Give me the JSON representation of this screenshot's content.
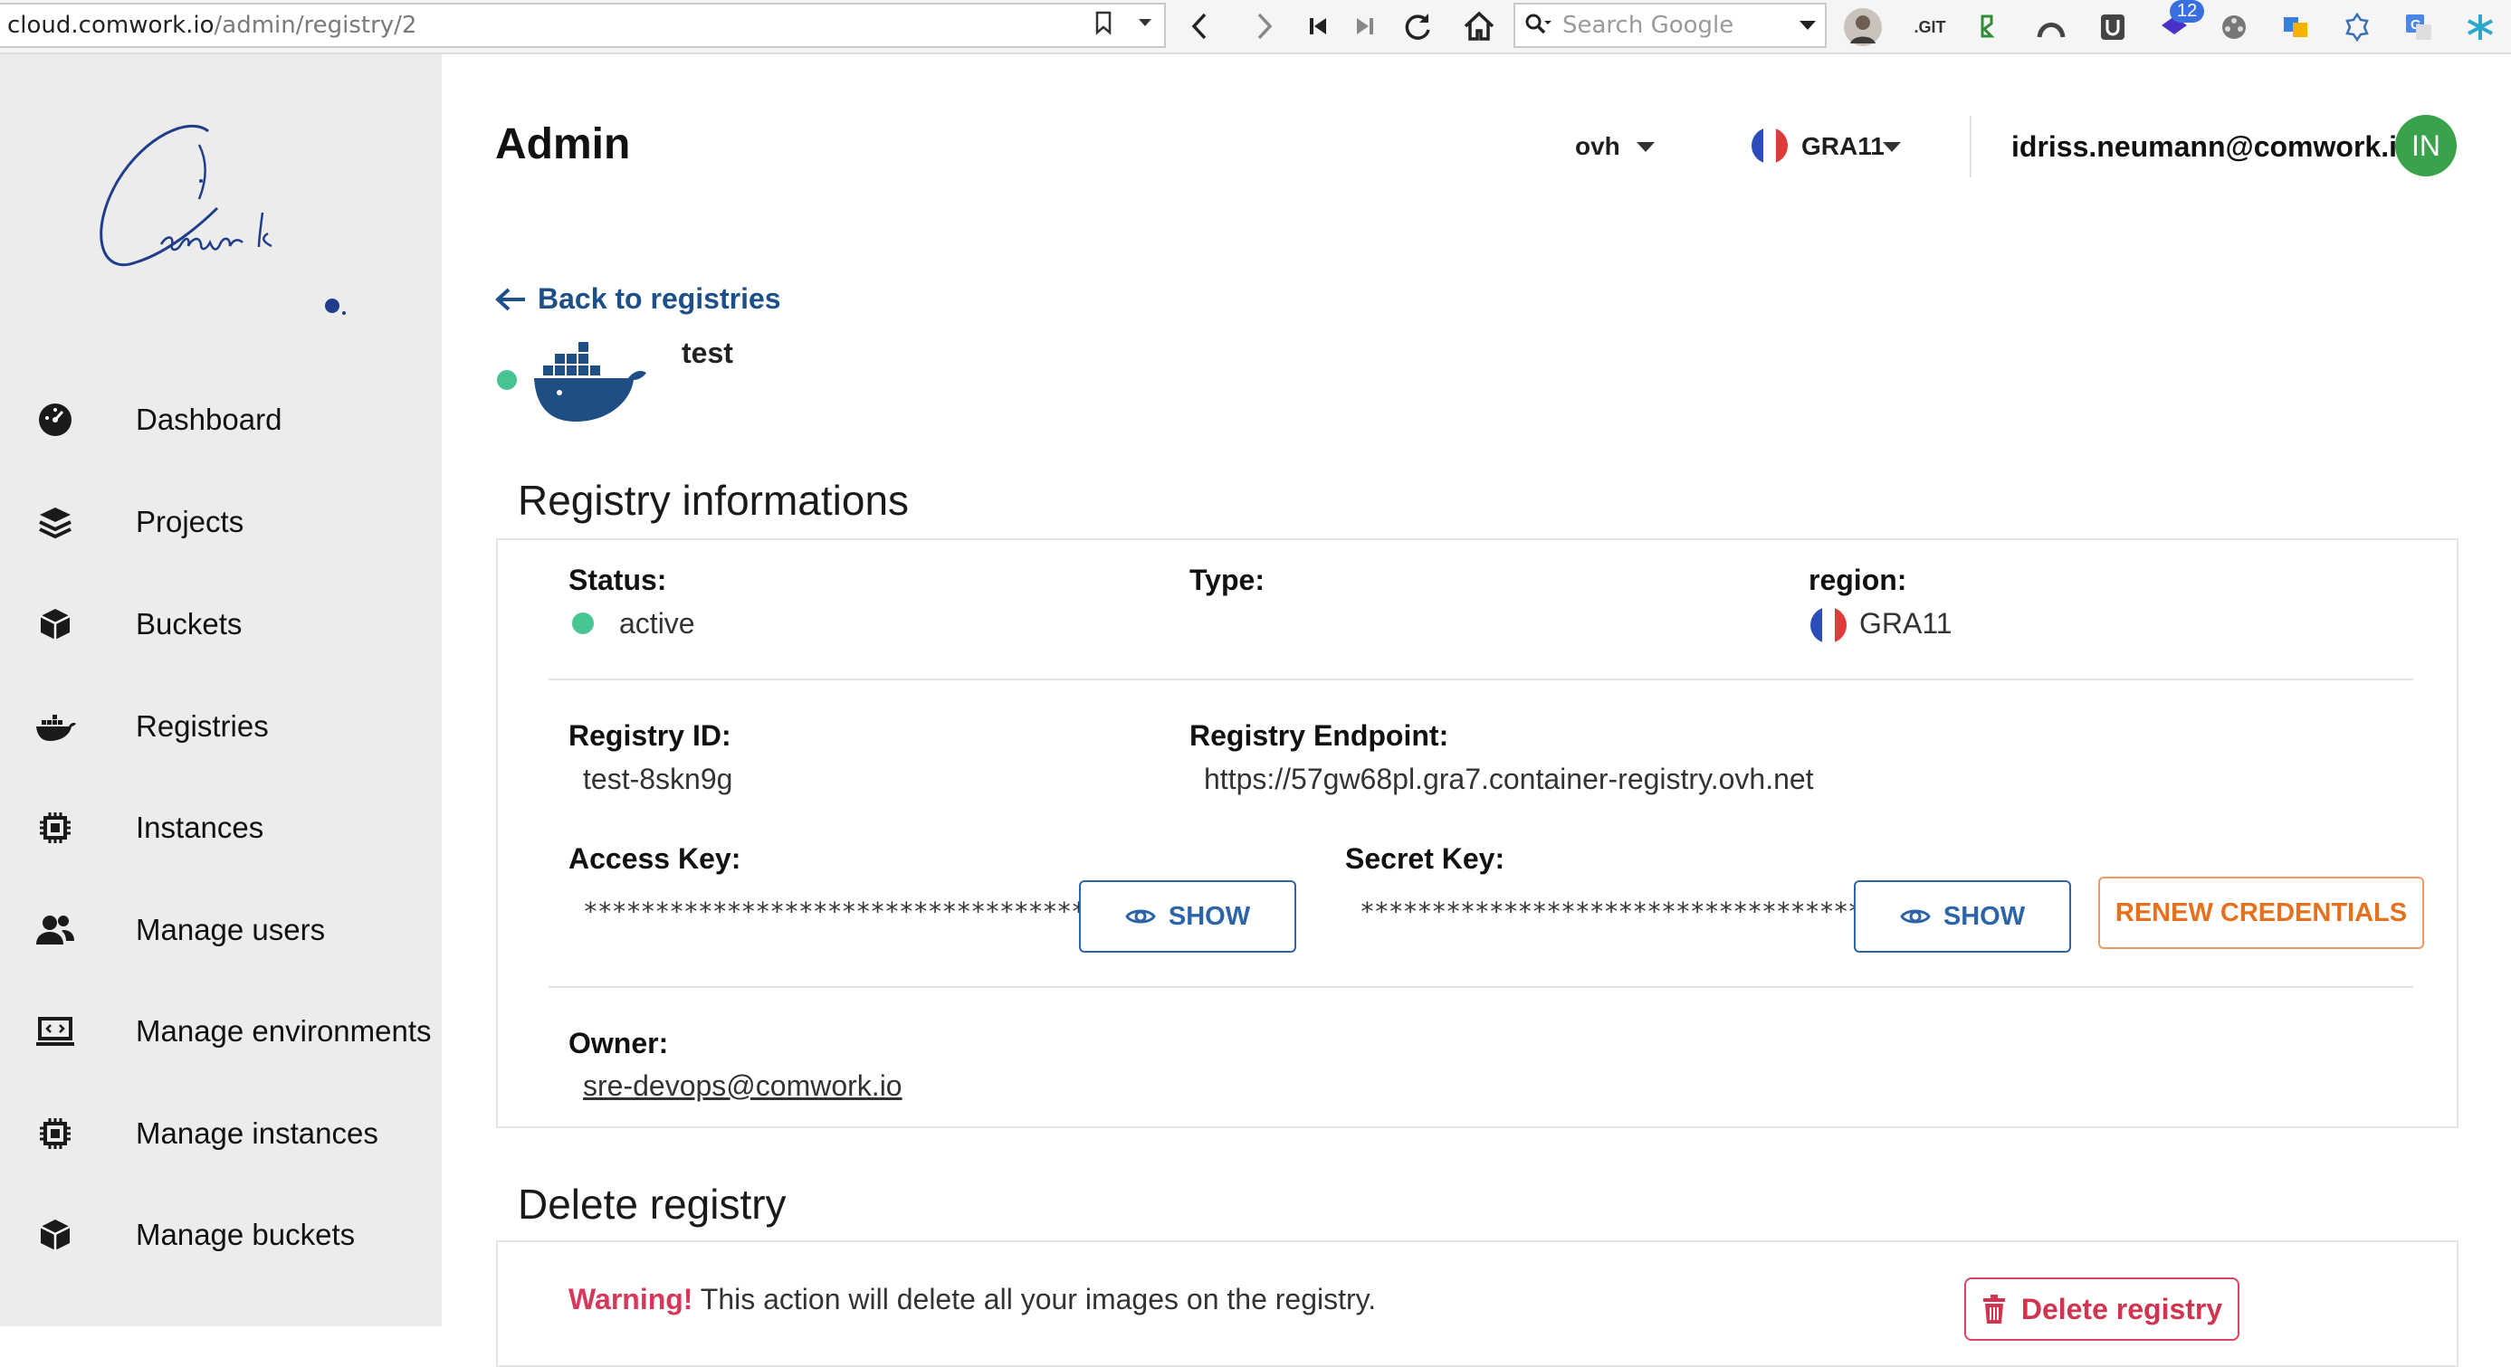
{
  "browser": {
    "url_host": "cloud.comwork.io",
    "url_path": "/admin/registry/2",
    "search_placeholder": "Search Google",
    "git_ext_label": ".GIT",
    "ext_badge": "12"
  },
  "sidebar": {
    "items": [
      {
        "label": "Dashboard",
        "icon": "dashboard-icon"
      },
      {
        "label": "Projects",
        "icon": "layers-icon"
      },
      {
        "label": "Buckets",
        "icon": "box-icon"
      },
      {
        "label": "Registries",
        "icon": "docker-icon"
      },
      {
        "label": "Instances",
        "icon": "chip-icon"
      },
      {
        "label": "Manage users",
        "icon": "users-icon"
      },
      {
        "label": "Manage environments",
        "icon": "laptop-code-icon"
      },
      {
        "label": "Manage instances",
        "icon": "chip-icon"
      },
      {
        "label": "Manage buckets",
        "icon": "box-icon"
      }
    ]
  },
  "header": {
    "title": "Admin",
    "provider": "ovh",
    "region": "GRA11",
    "email": "idriss.neumann@comwork.io",
    "avatar_initials": "IN"
  },
  "registry": {
    "back_label": "Back to registries",
    "name": "test",
    "info_title": "Registry informations",
    "status_label": "Status:",
    "status_value": "active",
    "type_label": "Type:",
    "region_label": "region:",
    "region_value": "GRA11",
    "id_label": "Registry ID:",
    "id_value": "test-8skn9g",
    "endpoint_label": "Registry Endpoint:",
    "endpoint_value": "https://57gw68pl.gra7.container-registry.ovh.net",
    "access_label": "Access Key:",
    "access_value": "****************************************",
    "secret_label": "Secret Key:",
    "secret_value": "****************************************",
    "show_label": "SHOW",
    "renew_label": "RENEW CREDENTIALS",
    "owner_label": "Owner:",
    "owner_value": "sre-devops@comwork.io"
  },
  "delete": {
    "title": "Delete registry",
    "warning_strong": "Warning!",
    "warning_text": " This action will delete all your images on the registry.",
    "button_label": "Delete registry"
  },
  "colors": {
    "accent": "#2c64a8",
    "status_active": "#47c593",
    "renew": "#e5711e",
    "danger": "#d1344f",
    "avatar": "#3aa24a"
  }
}
